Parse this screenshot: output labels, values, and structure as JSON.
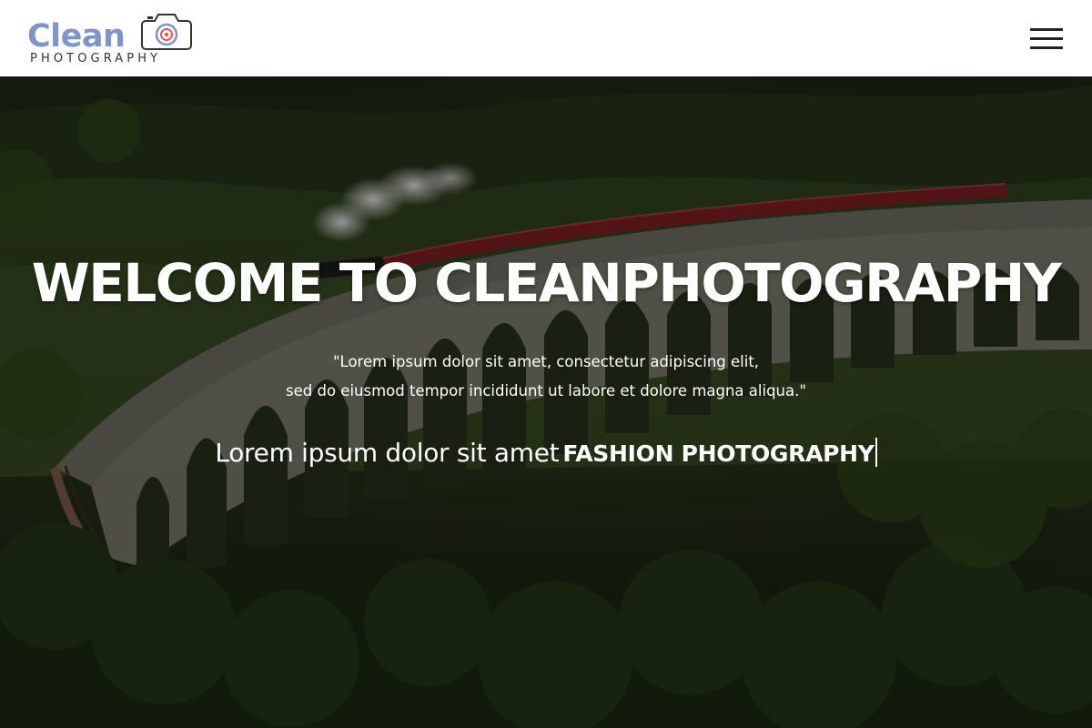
{
  "header": {
    "logo": {
      "word": "Clean",
      "subtitle": "PHOTOGRAPHY",
      "icon": "camera-icon"
    },
    "menu_icon": "hamburger-menu-icon"
  },
  "hero": {
    "title": "WELCOME TO CLEANPHOTOGRAPHY",
    "quote_line_1": "\"Lorem ipsum dolor sit amet, consectetur adipiscing elit,",
    "quote_line_2": "sed do eiusmod tempor incididunt ut labore et dolore magna aliqua.\"",
    "typed_static": "Lorem ipsum dolor sit amet",
    "typed_word": "FASHION PHOTOGRAPHY"
  },
  "colors": {
    "brand": "#7f95c7",
    "camera_lens": "#e05a4f",
    "header_bg": "#ffffff",
    "hero_text": "#ffffff"
  }
}
